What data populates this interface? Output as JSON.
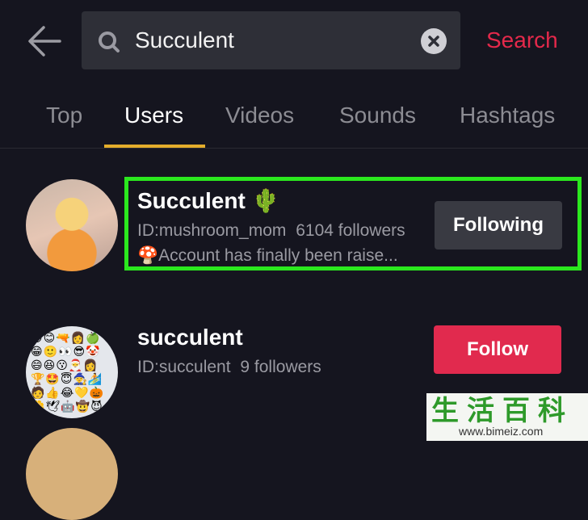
{
  "header": {
    "search_value": "Succulent",
    "search_action": "Search"
  },
  "tabs": [
    {
      "label": "Top"
    },
    {
      "label": "Users"
    },
    {
      "label": "Videos"
    },
    {
      "label": "Sounds"
    },
    {
      "label": "Hashtags"
    }
  ],
  "active_tab": "Users",
  "results": [
    {
      "name": "Succulent",
      "name_emoji": "🌵",
      "id": "ID:mushroom_mom",
      "followers": "6104 followers",
      "bio_emoji": "🍄",
      "bio": "Account has finally been raise...",
      "button": "Following"
    },
    {
      "name": "succulent",
      "id": "ID:succulent",
      "followers": "9 followers",
      "button": "Follow"
    }
  ],
  "colors": {
    "background": "#15151f",
    "accent": "#e4294b",
    "tab_indicator": "#e3ad2b",
    "highlight": "#2be81e"
  },
  "watermark": {
    "text": "生活百科",
    "url": "www.bimeiz.com"
  }
}
